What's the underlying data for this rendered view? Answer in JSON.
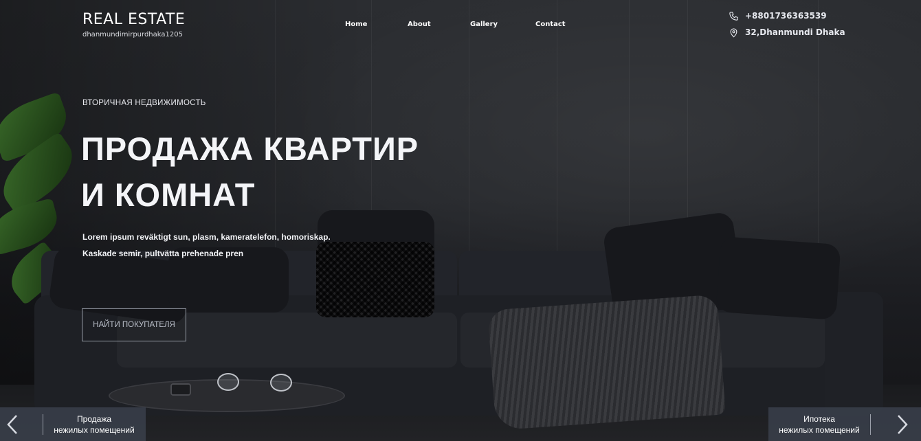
{
  "brand": {
    "title": "REAL ESTATE",
    "subtitle": "dhanmundimirpurdhaka1205"
  },
  "nav": {
    "items": [
      "Home",
      "About",
      "Gallery",
      "Contact"
    ]
  },
  "contact": {
    "phone": "+8801736363539",
    "address": "32,Dhanmundi Dhaka"
  },
  "hero": {
    "eyebrow": "ВТОРИЧНАЯ НЕДВИЖИМОСТЬ",
    "headline_line1": "ПРОДАЖА КВАРТИР",
    "headline_line2": "И КОМНАТ",
    "lede_line1": "Lorem ipsum reväktigt sun, plasm, kameratelefon, homoriskap.",
    "lede_line2": "Kaskade semir, pultvätta prehenade pren",
    "cta_label": "НАЙТИ ПОКУПАТЕЛЯ"
  },
  "slider": {
    "prev_line1": "Продажа",
    "prev_line2": "нежилых помещений",
    "next_line1": "Ипотека",
    "next_line2": "нежилых помещений",
    "prev_icon": "chevron-left-icon",
    "next_icon": "chevron-right-icon"
  },
  "colors": {
    "overlay": "#26282c",
    "accent": "#ffffff",
    "nav_bar": "#3a3f4b"
  }
}
